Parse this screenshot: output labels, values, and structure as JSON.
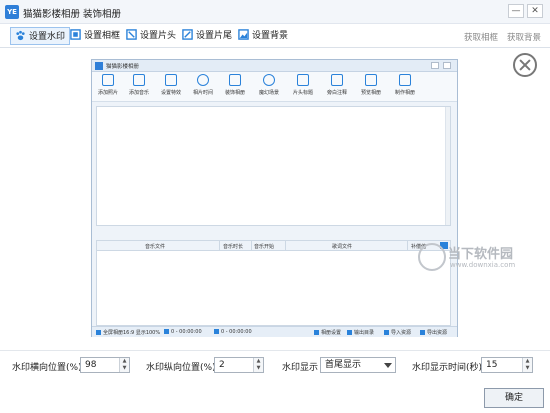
{
  "window": {
    "app_icon_text": "YE",
    "title": "猫猫影楼相册 装饰相册",
    "minimize_glyph": "—",
    "close_glyph": "✕"
  },
  "toolbar": {
    "items": [
      {
        "label": "设置水印",
        "icon": "paw-icon",
        "active": true
      },
      {
        "label": "设置相框",
        "icon": "frame-icon"
      },
      {
        "label": "设置片头",
        "icon": "intro-icon"
      },
      {
        "label": "设置片尾",
        "icon": "ending-icon"
      },
      {
        "label": "设置背景",
        "icon": "background-icon"
      }
    ],
    "right_links": [
      "获取相框",
      "获取背景"
    ]
  },
  "preview_window": {
    "title": "猫猫影楼相册",
    "tools": [
      {
        "label": "添加照片",
        "icon": "photo-icon"
      },
      {
        "label": "添加音乐",
        "icon": "music-icon"
      },
      {
        "label": "设置特效",
        "icon": "effects-icon"
      },
      {
        "label": "相片时间",
        "icon": "clock-icon"
      },
      {
        "label": "装饰相册",
        "icon": "decorate-icon"
      },
      {
        "label": "魔幻场景",
        "icon": "mask-icon"
      },
      {
        "label": "片头标题",
        "icon": "text-icon"
      },
      {
        "label": "旁白注释",
        "icon": "edit-icon"
      },
      {
        "label": "预览相册",
        "icon": "monitor-icon"
      },
      {
        "label": "制作相册",
        "icon": "grid-icon"
      }
    ],
    "music_columns": [
      "音乐文件",
      "音乐时长",
      "音乐开始",
      "歌词文件",
      "补偿值"
    ],
    "status": {
      "zoom": "全屏相册16:9 显示100%",
      "time1": "0 - 00:00:00",
      "time2": "0 - 00:00:00",
      "buttons": [
        "相册设置",
        "输出目录",
        "导入资源",
        "导出资源"
      ]
    }
  },
  "watermark_brand": {
    "name": "当下软件园",
    "url": "www.downxia.com"
  },
  "settings": {
    "h_pos_label": "水印横向位置(%)",
    "h_pos_value": "98",
    "v_pos_label": "水印纵向位置(%)",
    "v_pos_value": "2",
    "display_label": "水印显示",
    "display_value": "首尾显示",
    "duration_label": "水印显示时间(秒)",
    "duration_value": "15",
    "ok_label": "确定"
  },
  "colors": {
    "accent": "#2a82da",
    "title_bg": "#f3f6fa"
  }
}
